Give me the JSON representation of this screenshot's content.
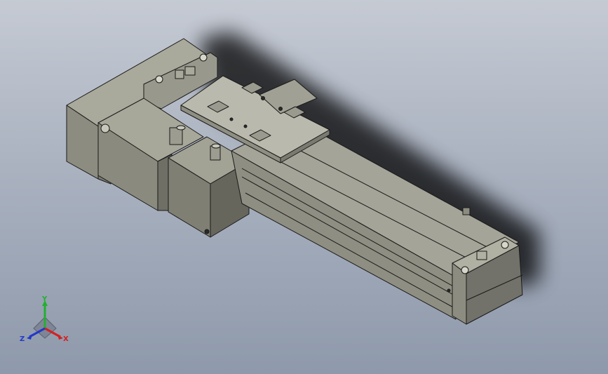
{
  "viewport": {
    "background_top": "#c5cad3",
    "background_bottom": "#8e99ab"
  },
  "model": {
    "body_color": "#8c8c80",
    "top_face_color": "#a9a99c",
    "side_face_color": "#6f6f65",
    "edge_color": "#1a1a1a",
    "plate_color": "#b9b9ad"
  },
  "triad": {
    "x_label": "X",
    "y_label": "Y",
    "z_label": "Z",
    "x_color": "#d42020",
    "y_color": "#22b030",
    "z_color": "#2438c8"
  }
}
